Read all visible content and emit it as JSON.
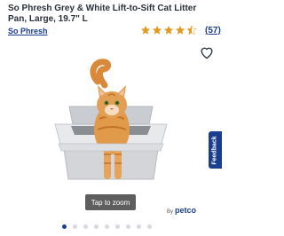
{
  "product": {
    "title": "So Phresh Grey & White Lift-to-Sift Cat Litter Pan, Large, 19.7\" L",
    "brand": "So Phresh",
    "rating": 4.5,
    "review_count": "(57)"
  },
  "gallery": {
    "zoom_label": "Tap to zoom",
    "by_label": "By",
    "brand_logo": "petco",
    "slides": 9,
    "active_slide": 0
  },
  "feedback_label": "Feedback",
  "colors": {
    "brand_blue": "#1b3d8f",
    "star_gold": "#e39a1f"
  },
  "icons": {
    "wishlist": "heart-icon",
    "rating": "star-icon"
  }
}
